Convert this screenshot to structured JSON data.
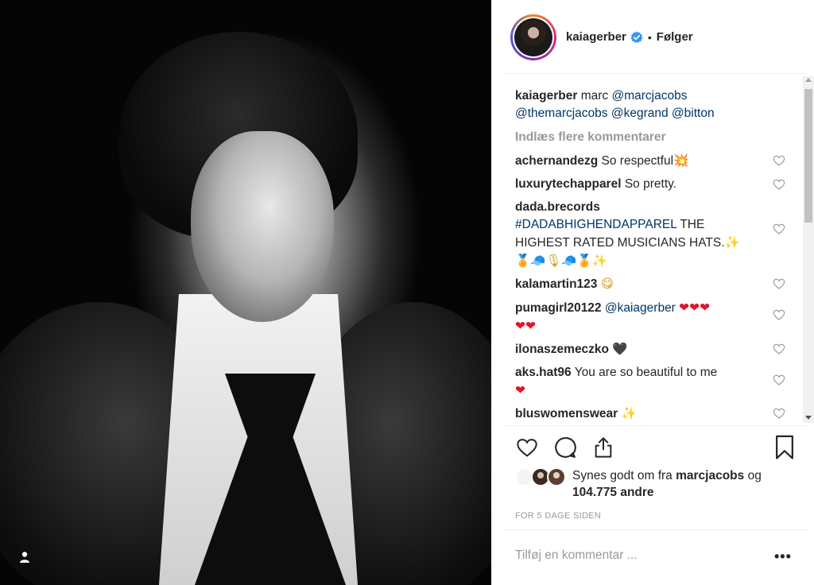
{
  "header": {
    "username": "kaiagerber",
    "separator": "•",
    "follow_label": "Følger"
  },
  "caption": {
    "username": "kaiagerber",
    "text": "marc",
    "mention1": "@marcjacobs",
    "mention2": "@themarcjacobs",
    "mention3": "@kegrand",
    "mention4": "@bitton"
  },
  "load_more": "Indlæs flere kommentarer",
  "comments": [
    {
      "user": "achernandezg",
      "text": "So respectful",
      "emoji": "💥"
    },
    {
      "user": "luxurytechapparel",
      "text": "So pretty."
    },
    {
      "user": "dada.brecords",
      "hashtag": "#DADABHIGHENDAPPAREL",
      "text": "THE HIGHEST RATED MUSICIANS HATS.",
      "emoji": "✨",
      "emoji_line": "🏅🧢🎙🧢🏅✨"
    },
    {
      "user": "kalamartin123",
      "emoji": "😋"
    },
    {
      "user": "pumagirl20122",
      "mention": "@kaiagerber",
      "emoji": "❤❤❤",
      "emoji_line": "❤❤"
    },
    {
      "user": "ilonaszemeczko",
      "emoji": "🖤"
    },
    {
      "user": "aks.hat96",
      "text": "You are so beautiful to me",
      "emoji_line": "❤"
    },
    {
      "user": "bluswomenswear",
      "emoji": "✨"
    }
  ],
  "actions": {
    "like": "heart-icon",
    "comment": "comment-icon",
    "share": "share-icon",
    "save": "bookmark-icon"
  },
  "likes": {
    "prefix": "Synes godt om fra",
    "user": "marcjacobs",
    "middle": "og",
    "count": "104.775",
    "suffix": "andre"
  },
  "timestamp": "FOR 5 DAGE SIDEN",
  "add_comment_placeholder": "Tilføj en kommentar ...",
  "more_label": "•••",
  "colors": {
    "link": "#003569",
    "verified": "#3897f0",
    "muted": "#999999",
    "text": "#262626"
  }
}
